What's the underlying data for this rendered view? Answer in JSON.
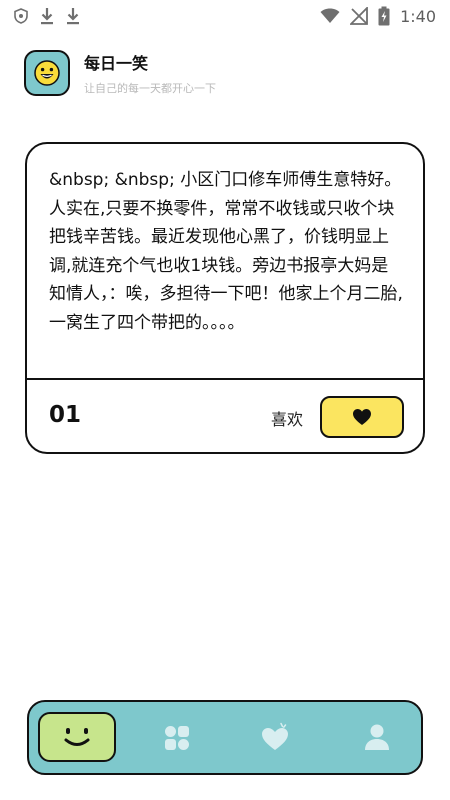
{
  "status_bar": {
    "time": "1:40",
    "left_icons": [
      "shield-icon",
      "download-icon",
      "download-icon"
    ],
    "right_icons": [
      "wifi-icon",
      "no-signal-icon",
      "battery-charging-icon"
    ]
  },
  "header": {
    "logo_icon": "smiley-face-icon",
    "title": "每日一笑",
    "subtitle": "让自己的每一天都开心一下"
  },
  "joke_card": {
    "text": "&nbsp; &nbsp; 小区门口修车师傅生意特好。人实在,只要不换零件，常常不收钱或只收个块把钱辛苦钱。最近发现他心黑了，价钱明显上调,就连充个气也收1块钱。旁边书报亭大妈是知情人，：唉，多担待一下吧！他家上个月二胎,一窝生了四个带把的。。。。",
    "index": "01",
    "like_label": "喜欢",
    "like_icon": "heart-icon"
  },
  "bottom_nav": {
    "items": [
      {
        "icon": "smiley-face-icon",
        "active": true
      },
      {
        "icon": "grid-icon",
        "active": false
      },
      {
        "icon": "heart-icon",
        "active": false
      },
      {
        "icon": "user-icon",
        "active": false
      }
    ]
  },
  "colors": {
    "teal": "#7ec8cc",
    "yellow": "#fbe560",
    "lime": "#c7e58c",
    "outline": "#111111",
    "subtitle_gray": "#b9b9b9"
  }
}
